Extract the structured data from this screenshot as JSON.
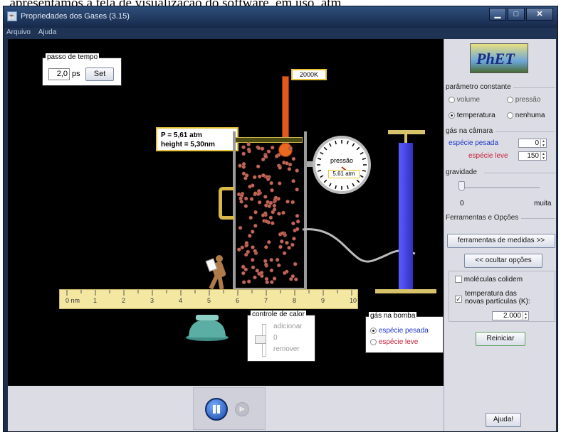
{
  "caption_above": ", apresentamos a tela de visualização do software, em uso, atm",
  "window": {
    "title": "Propriedades dos Gases (3.15)"
  },
  "menu": {
    "items": [
      "Arquivo",
      "Ajuda"
    ]
  },
  "timestep": {
    "legend": "passo de tempo",
    "value": "2,0",
    "unit": "ps",
    "set_label": "Set"
  },
  "thermometer": {
    "reading": "2000K"
  },
  "readout": {
    "pressure": "P = 5,61 atm",
    "height": "height = 5,30nm"
  },
  "gauge": {
    "label": "pressão",
    "value": "5,61 atm"
  },
  "ruler": {
    "ticks": [
      "0 nm",
      "1",
      "2",
      "3",
      "4",
      "5",
      "6",
      "7",
      "8",
      "9",
      "10"
    ]
  },
  "heat_control": {
    "legend": "controle de calor",
    "add_label": "adicionar",
    "zero_label": "0",
    "remove_label": "remover"
  },
  "pump_gas": {
    "legend": "gás na bomba",
    "heavy_label": "espécie pesada",
    "light_label": "espécie leve",
    "selected": "heavy"
  },
  "phet": {
    "logo": "PhET"
  },
  "constant_param": {
    "title": "parâmetro constante",
    "options": [
      "volume",
      "pressão",
      "temperatura",
      "nenhuma"
    ],
    "selected": "temperatura"
  },
  "chamber_gas": {
    "title": "gás na câmara",
    "heavy_label": "espécie pesada",
    "heavy_value": "0",
    "light_label": "espécie leve",
    "light_value": "150"
  },
  "gravity": {
    "title": "gravidade",
    "min_label": "0",
    "max_label": "muita",
    "level": 0
  },
  "tools": {
    "title": "Ferramentas e Opções",
    "measure_button": "ferramentas de medidas >>",
    "hide_button": "<< ocultar opções"
  },
  "options": {
    "collide_label": "moléculas colidem",
    "collide_checked": false,
    "temp_label": "temperatura das novas partículas (K):",
    "temp_checked": true,
    "temp_value": "2.000"
  },
  "reset_button": "Reiniciar",
  "help_button": "Ajuda!",
  "colors": {
    "canvas": "#000000",
    "panel": "#dcdde4",
    "heavy_species": "#1c35c7",
    "light_species": "#c8203a",
    "thermo_red": "#e05a1a",
    "pump_blue": "#4444dd"
  }
}
